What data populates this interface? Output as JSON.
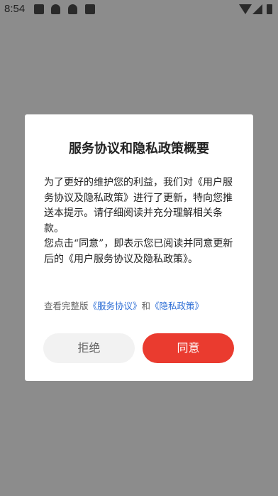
{
  "status_bar": {
    "time": "8:54",
    "icons": [
      "square-icon",
      "ghost-icon",
      "ghost-icon",
      "square-icon",
      "wifi-icon",
      "cell-signal-icon",
      "battery-icon"
    ]
  },
  "dialog": {
    "title": "服务协议和隐私政策概要",
    "body_paragraph_1": "为了更好的维护您的利益，我们对《用户服务协议及隐私政策》进行了更新，特向您推送本提示。请仔细阅读并充分理解相关条款。",
    "body_paragraph_2": "您点击“同意”，即表示您已阅读并同意更新后的《用户服务协议及隐私政策》。",
    "links_prefix": "查看完整版",
    "link_service": "《服务协议》",
    "links_joiner": "和",
    "link_privacy": "《隐私政策》",
    "reject_label": "拒绝",
    "agree_label": "同意"
  },
  "colors": {
    "overlay": "#8c8c8c",
    "accent": "#ea3b2f",
    "link": "#2f6fd6"
  }
}
